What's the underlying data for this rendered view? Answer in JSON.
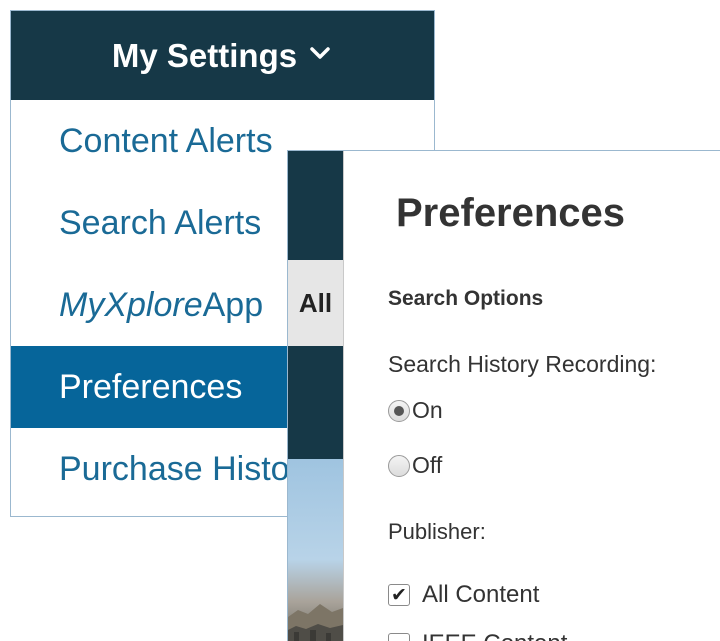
{
  "settings_menu": {
    "header": "My Settings",
    "items": [
      {
        "label": "Content Alerts",
        "active": false
      },
      {
        "label": "Search Alerts",
        "active": false
      },
      {
        "label_italic": "MyXplore",
        "label_rest": " App",
        "active": false
      },
      {
        "label": "Preferences",
        "active": true
      },
      {
        "label": "Purchase History",
        "active": false
      }
    ]
  },
  "overlay": {
    "strip_label": "All",
    "title": "Preferences",
    "search_options": {
      "heading": "Search Options",
      "history_label": "Search History Recording:",
      "options": [
        {
          "label": "On",
          "checked": true
        },
        {
          "label": "Off",
          "checked": false
        }
      ]
    },
    "publisher": {
      "label": "Publisher:",
      "options": [
        {
          "label": "All Content",
          "checked": true
        },
        {
          "label": "IEEE Content",
          "checked": false
        }
      ]
    }
  },
  "colors": {
    "header_bg": "#163847",
    "active_bg": "#06659a",
    "link_color": "#1a6a96"
  }
}
